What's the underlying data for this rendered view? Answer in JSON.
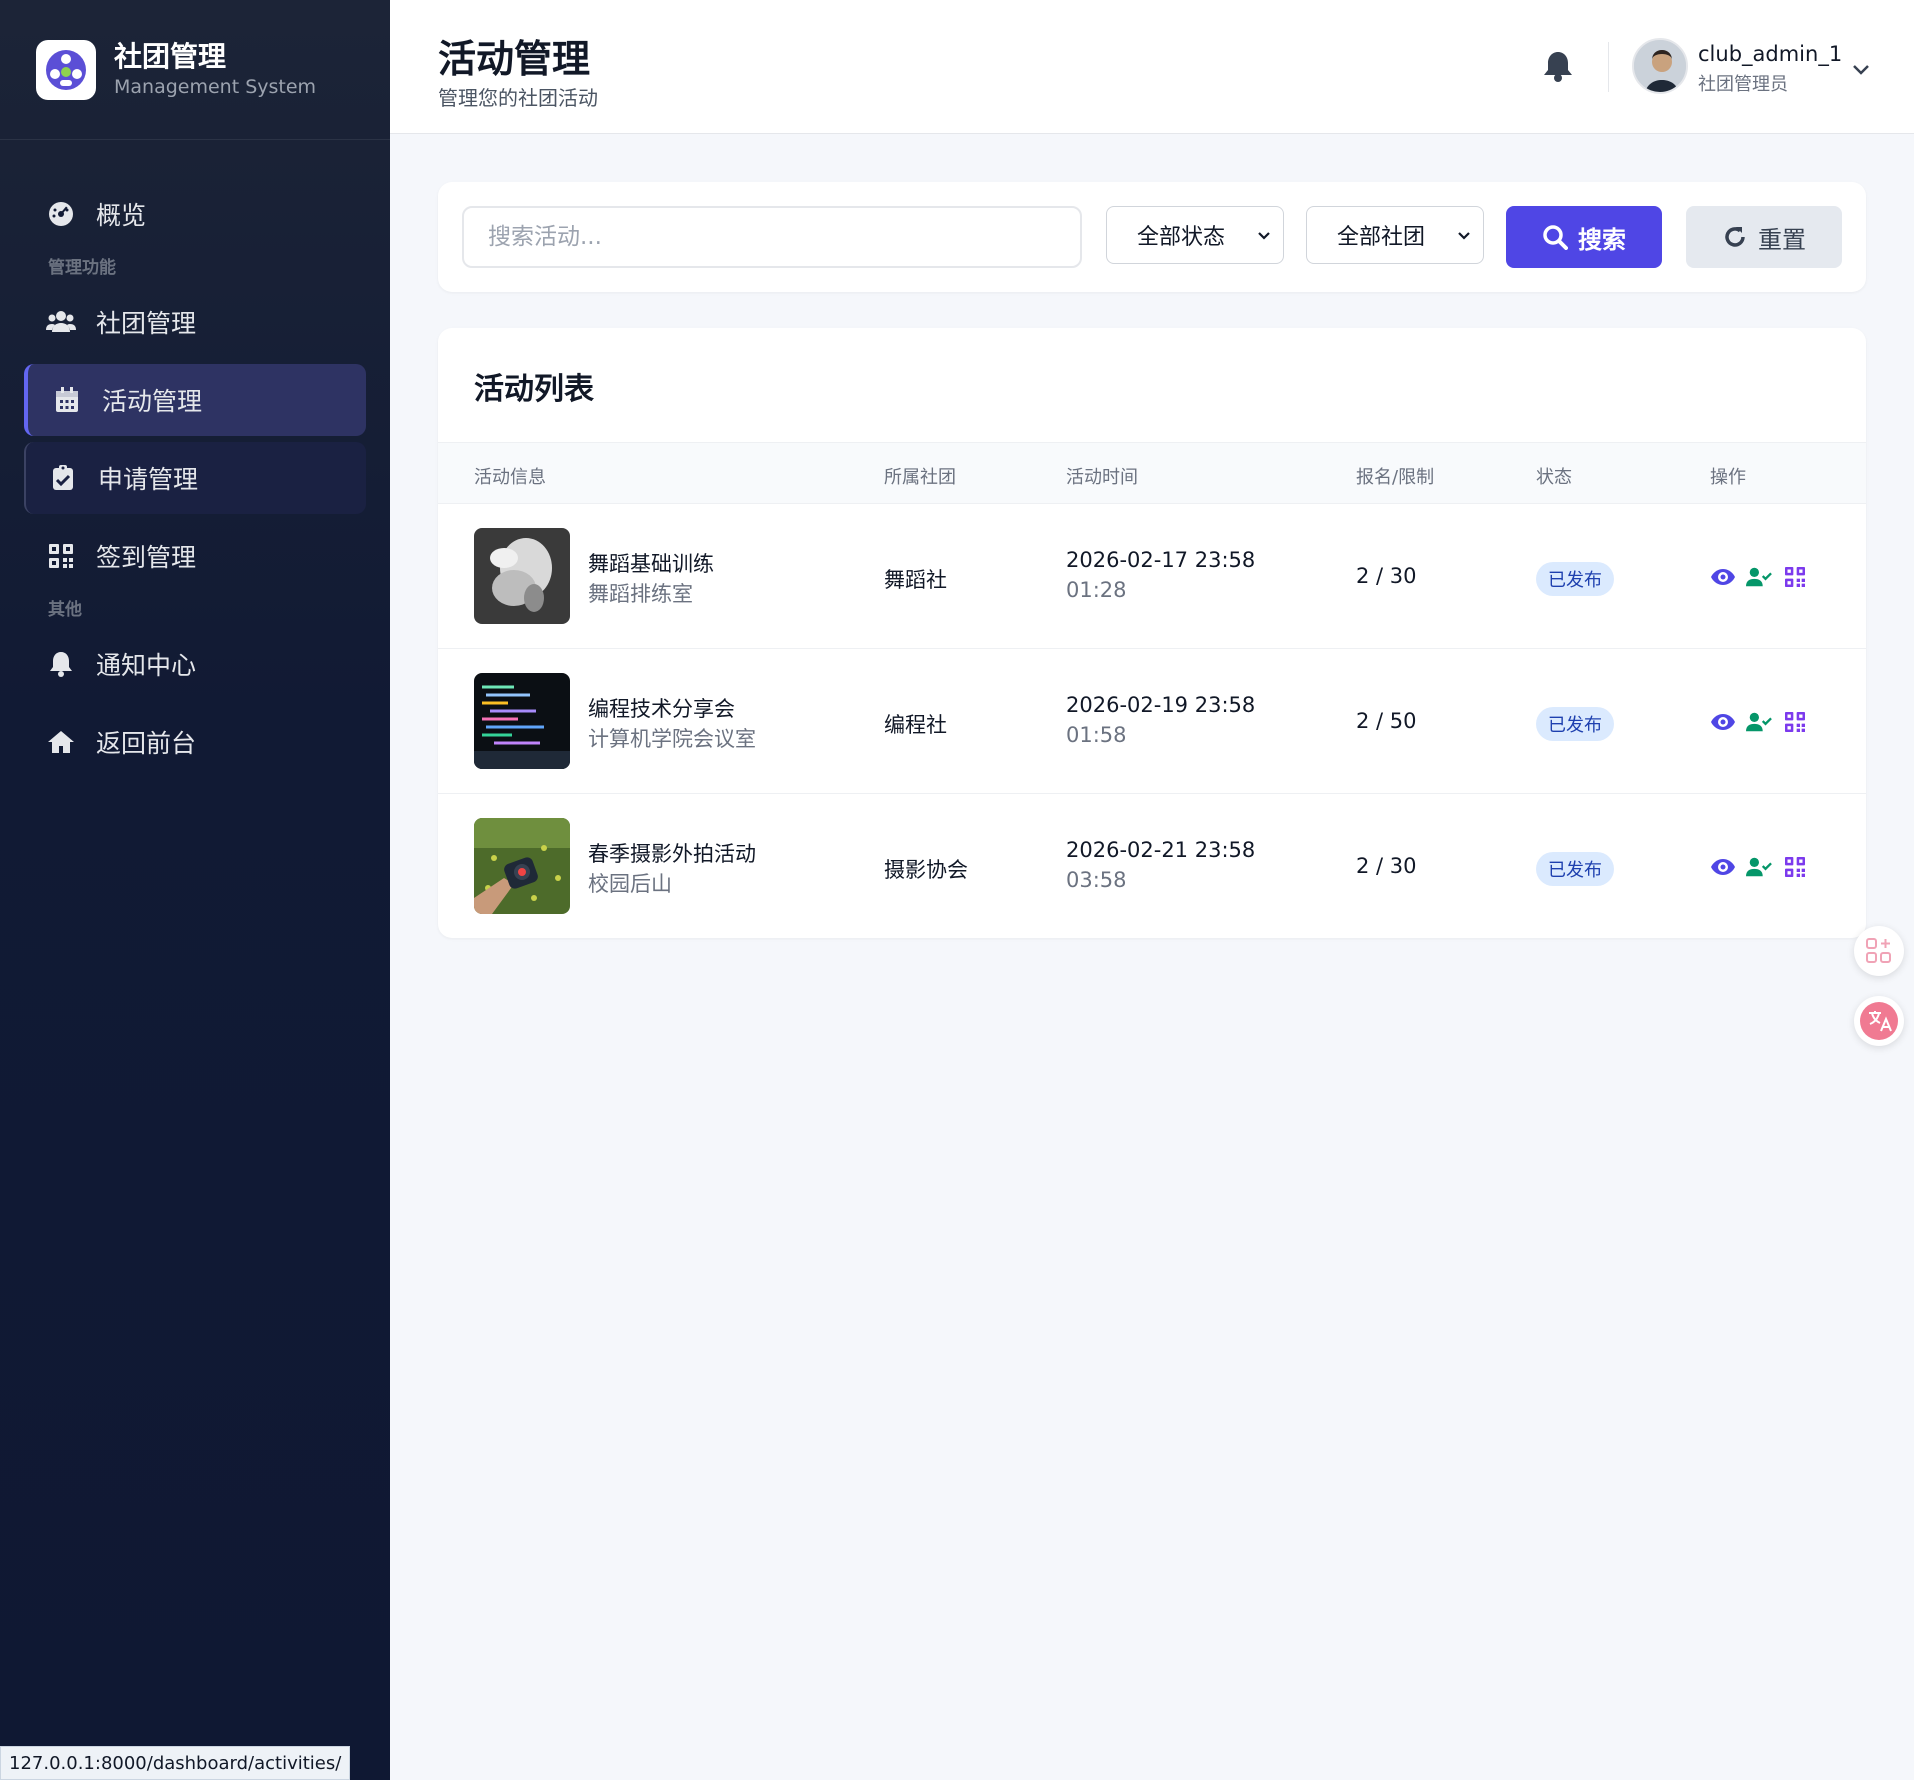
{
  "brand": {
    "title": "社团管理",
    "subtitle": "Management System"
  },
  "sidebar": {
    "items": [
      {
        "label": "概览",
        "icon": "dashboard-icon"
      },
      {
        "section": "管理功能"
      },
      {
        "label": "社团管理",
        "icon": "users-icon"
      },
      {
        "label": "活动管理",
        "icon": "calendar-icon",
        "active": true
      },
      {
        "label": "申请管理",
        "icon": "clipboard-check-icon"
      },
      {
        "label": "签到管理",
        "icon": "qrcode-icon"
      },
      {
        "section": "其他"
      },
      {
        "label": "通知中心",
        "icon": "bell-icon"
      },
      {
        "label": "返回前台",
        "icon": "home-icon"
      }
    ]
  },
  "header": {
    "title": "活动管理",
    "subtitle": "管理您的社团活动",
    "user": {
      "name": "club_admin_1",
      "role": "社团管理员"
    }
  },
  "search": {
    "placeholder": "搜索活动...",
    "status_select": "全部状态",
    "club_select": "全部社团",
    "search_label": "搜索",
    "reset_label": "重置"
  },
  "list": {
    "title": "活动列表",
    "columns": [
      "活动信息",
      "所属社团",
      "活动时间",
      "报名/限制",
      "状态",
      "操作"
    ],
    "rows": [
      {
        "name": "舞蹈基础训练",
        "place": "舞蹈排练室",
        "club": "舞蹈社",
        "start": "2026-02-17 23:58",
        "end": "01:28",
        "registration": "2 / 30",
        "status": "已发布"
      },
      {
        "name": "编程技术分享会",
        "place": "计算机学院会议室",
        "club": "编程社",
        "start": "2026-02-19 23:58",
        "end": "01:58",
        "registration": "2 / 50",
        "status": "已发布"
      },
      {
        "name": "春季摄影外拍活动",
        "place": "校园后山",
        "club": "摄影协会",
        "start": "2026-02-21 23:58",
        "end": "03:58",
        "registration": "2 / 30",
        "status": "已发布"
      }
    ]
  },
  "statusbar": {
    "url": "127.0.0.1:8000/dashboard/activities/"
  },
  "colors": {
    "accent": "#4f46e5",
    "sidebar": "#111a34",
    "badge_bg": "#dbeafe",
    "badge_text": "#1e40af",
    "ops_green": "#059669",
    "ops_purple": "#7c3aed"
  }
}
